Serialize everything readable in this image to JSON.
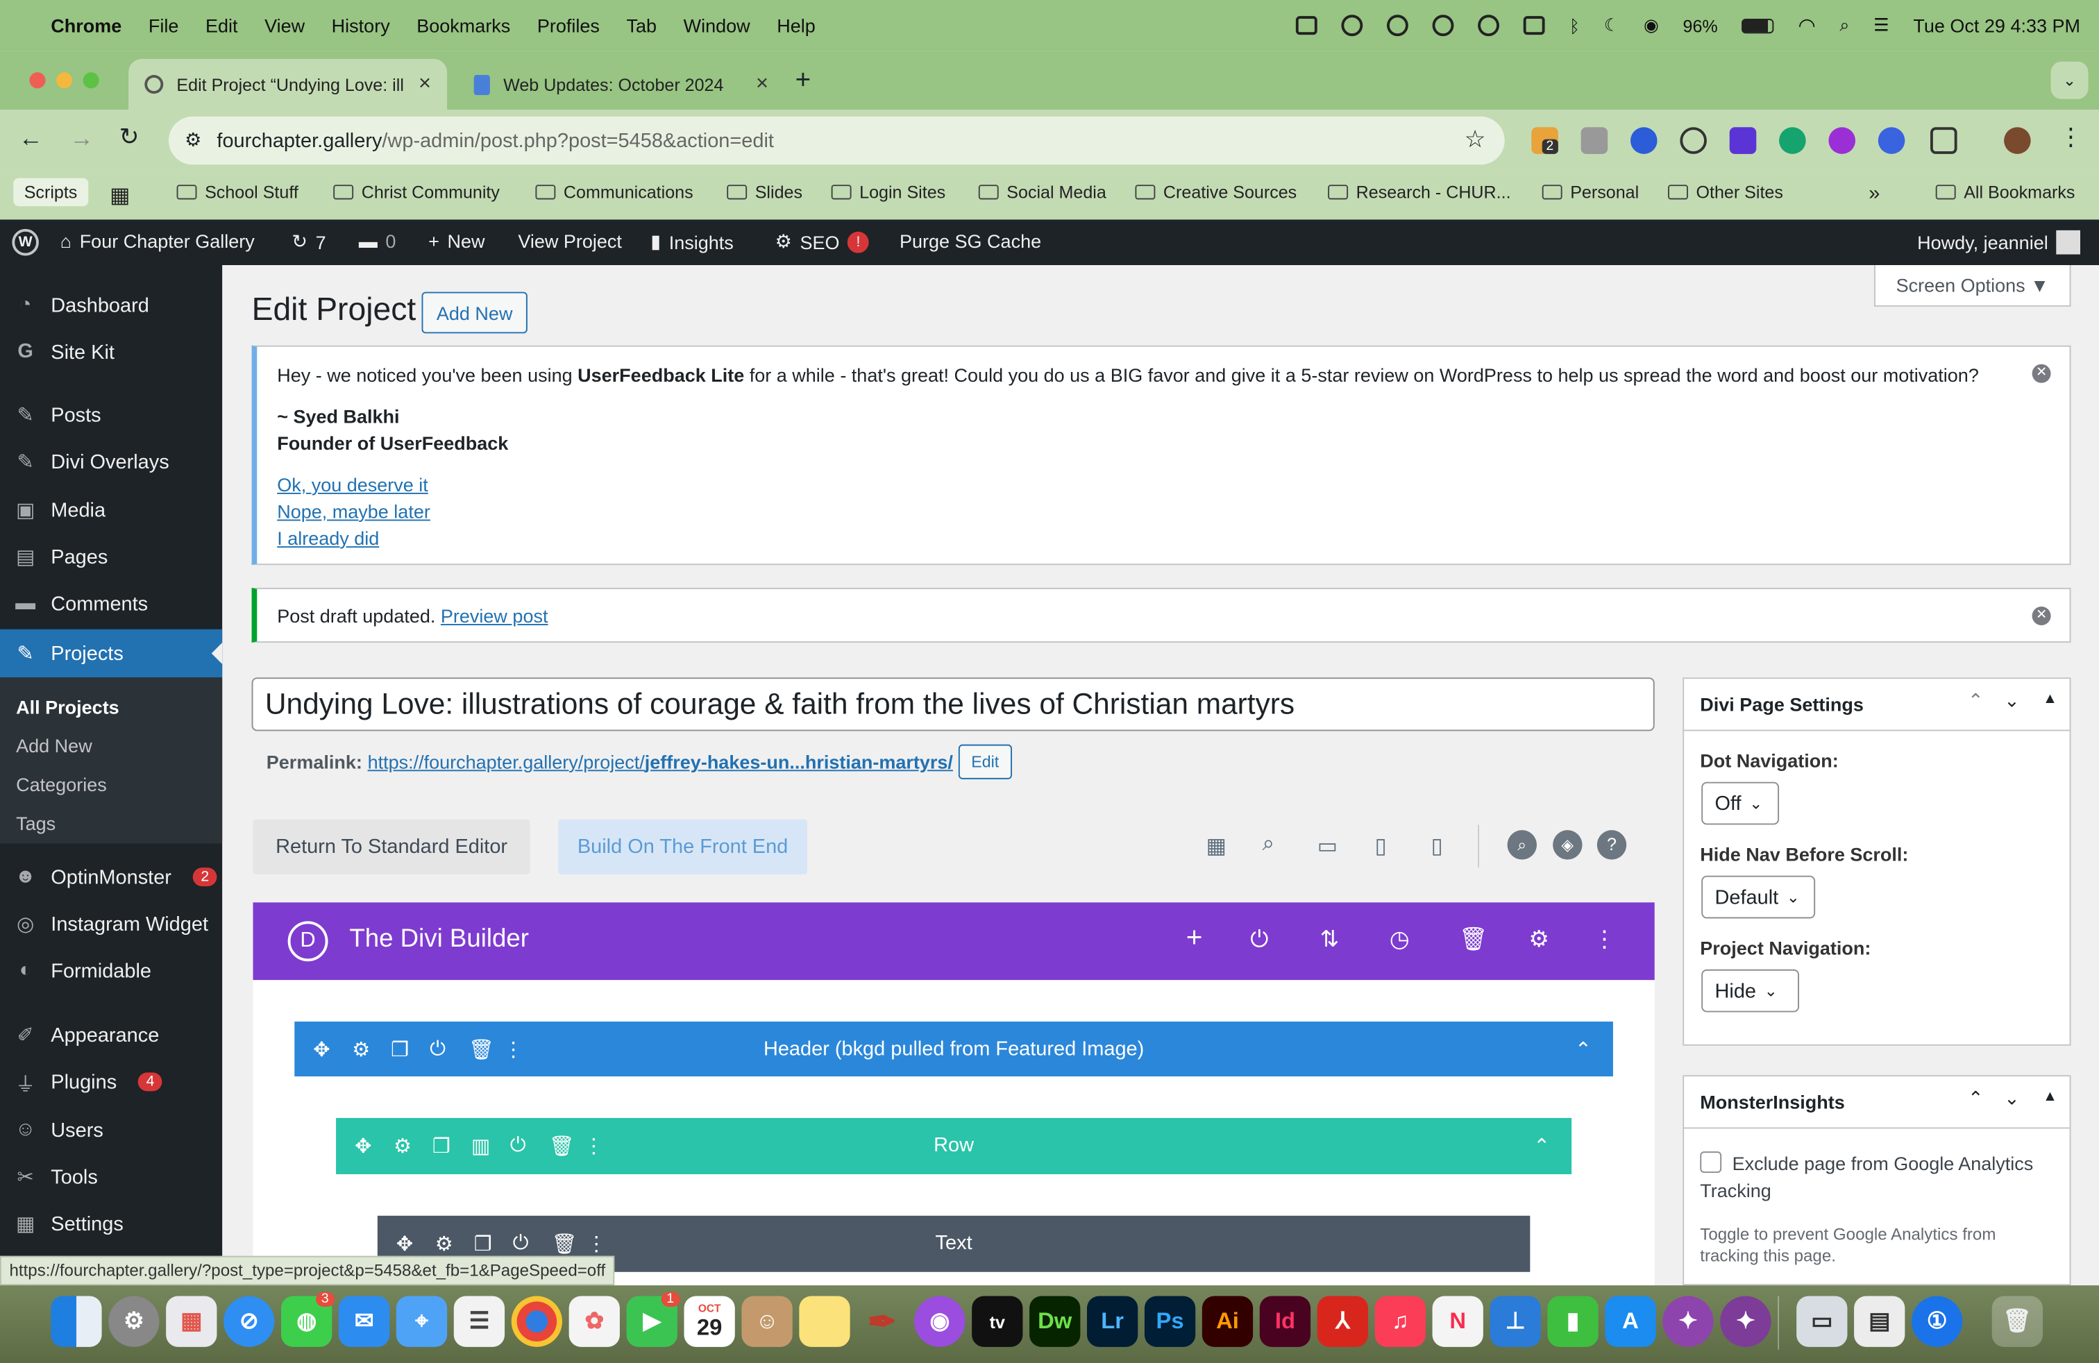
{
  "menubar": {
    "app": "Chrome",
    "items": [
      "File",
      "Edit",
      "View",
      "History",
      "Bookmarks",
      "Profiles",
      "Tab",
      "Window",
      "Help"
    ],
    "battery": "96%",
    "datetime": "Tue Oct 29  4:33 PM"
  },
  "tabs": [
    {
      "title": "Edit Project “Undying Love: ill",
      "active": true
    },
    {
      "title": "Web Updates: October 2024",
      "active": false
    }
  ],
  "address": {
    "host": "fourchapter.gallery",
    "path": "/wp-admin/post.php?post=5458&action=edit",
    "ext_badge": "2"
  },
  "bookmarks": {
    "scripts": "Scripts",
    "folders": [
      "School Stuff",
      "Christ Community",
      "Communications",
      "Slides",
      "Login Sites",
      "Social Media",
      "Creative Sources",
      "Research - CHUR...",
      "Personal",
      "Other Sites"
    ],
    "more": "»",
    "all": "All Bookmarks"
  },
  "adminbar": {
    "site": "Four Chapter Gallery",
    "updates": "7",
    "comments": "0",
    "new": "New",
    "view": "View Project",
    "insights": "Insights",
    "seo": "SEO",
    "seo_badge": "!",
    "purge": "Purge SG Cache",
    "howdy": "Howdy, jeanniel"
  },
  "sidebar": {
    "items": [
      {
        "label": "Dashboard",
        "icon": "dashboard-icon"
      },
      {
        "label": "Site Kit",
        "icon": "g-icon"
      },
      {
        "label": "Posts",
        "icon": "pin-icon"
      },
      {
        "label": "Divi Overlays",
        "icon": "pin-icon"
      },
      {
        "label": "Media",
        "icon": "media-icon"
      },
      {
        "label": "Pages",
        "icon": "pages-icon"
      },
      {
        "label": "Comments",
        "icon": "comment-icon"
      },
      {
        "label": "Projects",
        "icon": "pin-icon"
      }
    ],
    "sub": [
      "All Projects",
      "Add New",
      "Categories",
      "Tags"
    ],
    "items2": [
      {
        "label": "OptinMonster",
        "badge": "2"
      },
      {
        "label": "Instagram Widget"
      },
      {
        "label": "Formidable"
      },
      {
        "label": "Appearance"
      },
      {
        "label": "Plugins",
        "badge": "4"
      },
      {
        "label": "Users"
      },
      {
        "label": "Tools"
      },
      {
        "label": "Settings"
      }
    ]
  },
  "page": {
    "heading": "Edit Project",
    "add_new": "Add New",
    "screen_options": "Screen Options ▼"
  },
  "feedback_notice": {
    "text_before": "Hey - we noticed you've been using ",
    "bold": "UserFeedback Lite",
    "text_after": " for a while - that's great! Could you do us a BIG favor and give it a 5-star review on WordPress to help us spread the word and boost our motivation?",
    "sign1": "~ Syed Balkhi",
    "sign2": "Founder of UserFeedback",
    "links": [
      "Ok, you deserve it",
      "Nope, maybe later",
      "I already did"
    ]
  },
  "draft_notice": {
    "text": "Post draft updated. ",
    "link": "Preview post"
  },
  "post": {
    "title": "Undying Love: illustrations of courage & faith from the lives of Christian martyrs",
    "permalink_label": "Permalink:",
    "permalink_base": "https://fourchapter.gallery/project/",
    "permalink_slug": "jeffrey-hakes-un...hristian-martyrs/",
    "edit": "Edit"
  },
  "builder": {
    "standard_editor": "Return To Standard Editor",
    "front_end": "Build On The Front End",
    "title": "The Divi Builder",
    "section": "Header (bkgd pulled from Featured Image)",
    "row": "Row",
    "module": "Text"
  },
  "divi_settings": {
    "title": "Divi Page Settings",
    "dot_label": "Dot Navigation:",
    "dot_value": "Off",
    "hide_label": "Hide Nav Before Scroll:",
    "hide_value": "Default",
    "proj_label": "Project Navigation:",
    "proj_value": "Hide"
  },
  "monsterinsights": {
    "title": "MonsterInsights",
    "checkbox": "Exclude page from Google Analytics Tracking",
    "help": "Toggle to prevent Google Analytics from tracking this page."
  },
  "status_url": "https://fourchapter.gallery/?post_type=project&p=5458&et_fb=1&PageSpeed=off",
  "dock": {
    "calendar_month": "OCT",
    "calendar_day": "29",
    "messages_badge": "3",
    "facetime_badge": "1"
  },
  "colors": {
    "divi_purple": "#7e3bd0",
    "section_blue": "#2b87da",
    "row_green": "#29c4a9",
    "module_gray": "#4c5866",
    "wp_dark": "#1d2327",
    "wp_blue": "#2271b1"
  }
}
